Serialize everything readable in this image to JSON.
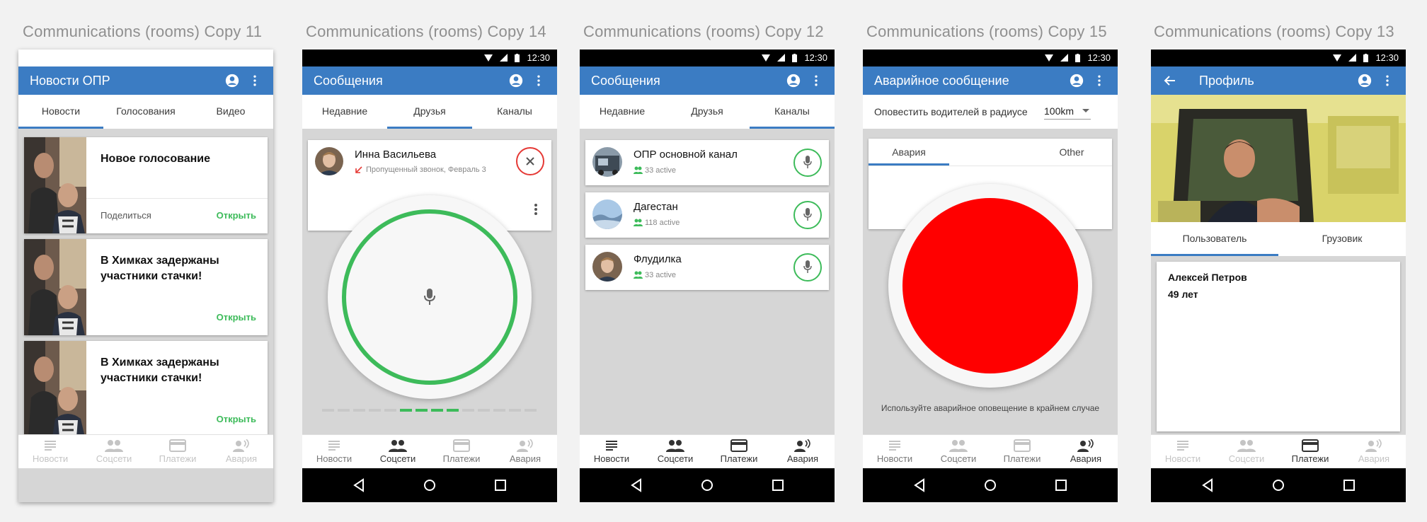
{
  "artboards": [
    "Communications (rooms) Copy 11",
    "Communications (rooms) Copy 14",
    "Communications (rooms) Copy 12",
    "Communications (rooms) Copy 15",
    "Communications (rooms) Copy 13"
  ],
  "status_time": "12:30",
  "bottom_nav": [
    "Новости",
    "Соцсети",
    "Платежи",
    "Авария"
  ],
  "news_screen": {
    "title": "Новости ОПР",
    "tabs": [
      "Новости",
      "Голосования",
      "Видео"
    ],
    "cards": [
      {
        "title": "Новое голосование",
        "share": "Поделиться",
        "open": "Открыть"
      },
      {
        "title": "В Химках задержаны участники стачки!",
        "open": "Открыть"
      },
      {
        "title": "В Химках задержаны участники стачки!",
        "open": "Открыть"
      }
    ]
  },
  "friends_screen": {
    "title": "Сообщения",
    "tabs": [
      "Недавние",
      "Друзья",
      "Каналы"
    ],
    "contact_name": "Инна Васильева",
    "contact_status": "Пропущенный звонок, Февраль 3",
    "level_segments_on": [
      5,
      6,
      7,
      8
    ],
    "level_segments_total": 14
  },
  "channels_screen": {
    "title": "Сообщения",
    "tabs": [
      "Недавние",
      "Друзья",
      "Каналы"
    ],
    "channels": [
      {
        "name": "ОПР основной канал",
        "active": "33 active"
      },
      {
        "name": "Дагестан",
        "active": "118 active"
      },
      {
        "name": "Флудилка",
        "active": "33 active"
      }
    ]
  },
  "emergency_screen": {
    "title": "Аварийное сообщение",
    "radius_label": "Оповестить водителей в радиусе",
    "radius_value": "100km",
    "tabs": [
      "Авария",
      "Other"
    ],
    "hint": "Используйте аварийное оповещение в крайнем случае"
  },
  "profile_screen": {
    "title": "Профиль",
    "tabs": [
      "Пользователь",
      "Грузовик"
    ],
    "name": "Алексей Петров",
    "age": "49 лет"
  },
  "colors": {
    "appbar": "#3b7cc3",
    "accent_green": "#3dbb5a",
    "alarm_red": "#ff0000",
    "close_red": "#e53935"
  }
}
